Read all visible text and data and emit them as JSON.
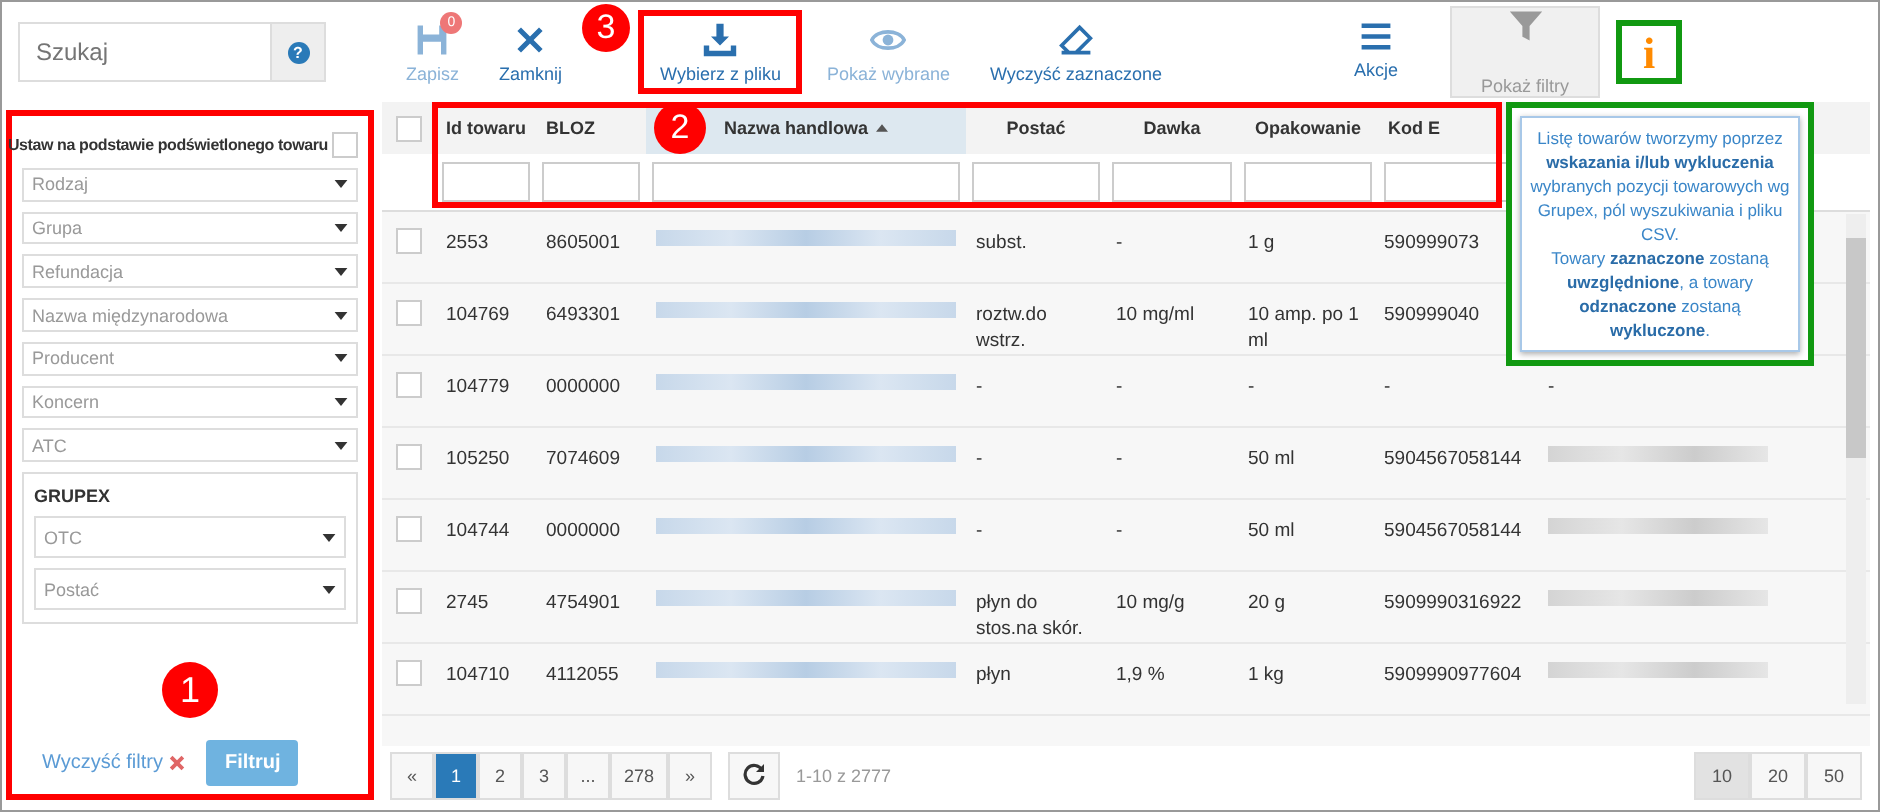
{
  "search": {
    "placeholder": "Szukaj",
    "help": "?"
  },
  "toolbar": [
    {
      "kind": "save",
      "label": "Zapisz",
      "disabled": true,
      "badge": "0"
    },
    {
      "kind": "close",
      "label": "Zamknij",
      "disabled": false
    },
    {
      "kind": "download",
      "label": "Wybierz z pliku",
      "disabled": false,
      "annotation": {
        "label": "3",
        "color": "#ff0000"
      }
    },
    {
      "kind": "eye",
      "label": "Pokaż wybrane",
      "disabled": true
    },
    {
      "kind": "eraser",
      "label": "Wyczyść zaznaczone",
      "disabled": false
    }
  ],
  "actions": {
    "label": "Akcje"
  },
  "show_filters": {
    "label": "Pokaż filtry",
    "selected": true
  },
  "info_button": {
    "label": "i",
    "annotation": {
      "color": "#119911"
    }
  },
  "tooltip": {
    "text": "Listę towarów tworzymy poprzez **wskazania i/lub wykluczenia** wybranych pozycji towarowych wg Grupex, pól wyszukiwania i pliku CSV.\nTowary **zaznaczone** zostaną **uwzględnione**, a towary **odznaczone** zostaną **wykluczone**.",
    "annotation": {
      "color": "#119911"
    }
  },
  "filters": {
    "annotation": {
      "label": "1",
      "color": "#ff0000"
    },
    "highlight_label": "Ustaw na podstawie podświetlonego towaru",
    "highlight_checked": false,
    "selects": [
      {
        "placeholder": "Rodzaj"
      },
      {
        "placeholder": "Grupa"
      },
      {
        "placeholder": "Refundacja"
      },
      {
        "placeholder": "Nazwa międzynarodowa"
      },
      {
        "placeholder": "Producent"
      },
      {
        "placeholder": "Koncern"
      },
      {
        "placeholder": "ATC"
      }
    ],
    "grupex": {
      "title": "GRUPEX",
      "selects": [
        {
          "placeholder": "OTC"
        },
        {
          "placeholder": "Postać"
        }
      ]
    },
    "clear": "Wyczyść filtry",
    "submit": "Filtruj"
  },
  "table": {
    "annotation": {
      "label": "2",
      "color": "#ff0000"
    },
    "select_all_checked": false,
    "columns": [
      {
        "label": "Id towaru",
        "sorted": false
      },
      {
        "label": "BLOZ",
        "sorted": false
      },
      {
        "label": "Nazwa handlowa",
        "sorted": true
      },
      {
        "label": "Postać",
        "sorted": false
      },
      {
        "label": "Dawka",
        "sorted": false
      },
      {
        "label": "Opakowanie",
        "sorted": false
      },
      {
        "label": "Kod E",
        "sorted": false
      }
    ],
    "rows": [
      {
        "checked": false,
        "id": "2553",
        "bloz": "8605001",
        "form": "subst.",
        "dose": "-",
        "pack": "1 g",
        "ean": "590999073"
      },
      {
        "checked": false,
        "id": "104769",
        "bloz": "6493301",
        "form": "roztw.do wstrz.",
        "dose": "10 mg/ml",
        "pack": "10 amp. po 1 ml",
        "ean": "590999040"
      },
      {
        "checked": false,
        "id": "104779",
        "bloz": "0000000",
        "form": "-",
        "dose": "-",
        "pack": "-",
        "ean": "-",
        "producer": "-",
        "producer_redacted": false
      },
      {
        "checked": false,
        "id": "105250",
        "bloz": "7074609",
        "form": "-",
        "dose": "-",
        "pack": "50 ml",
        "ean": "5904567058144",
        "producer": "",
        "producer_redacted": true
      },
      {
        "checked": false,
        "id": "104744",
        "bloz": "0000000",
        "form": "-",
        "dose": "-",
        "pack": "50 ml",
        "ean": "5904567058144",
        "producer": "",
        "producer_redacted": true
      },
      {
        "checked": false,
        "id": "2745",
        "bloz": "4754901",
        "form": "płyn do stos.na skór.",
        "dose": "10 mg/g",
        "pack": "20 g",
        "ean": "5909990316922",
        "producer": "",
        "producer_redacted": true
      },
      {
        "checked": false,
        "id": "104710",
        "bloz": "4112055",
        "form": "płyn",
        "dose": "1,9 %",
        "pack": "1 kg",
        "ean": "5909990977604",
        "producer": "",
        "producer_redacted": true
      }
    ]
  },
  "pagination": {
    "prev": "«",
    "next": "»",
    "pages": [
      {
        "label": "1",
        "selected": true
      },
      {
        "label": "2",
        "selected": false
      },
      {
        "label": "3",
        "selected": false
      },
      {
        "label": "...",
        "selected": false
      },
      {
        "label": "278",
        "selected": false
      }
    ],
    "summary": "1-10 z 2777",
    "sizes": [
      {
        "label": "10",
        "selected": true
      },
      {
        "label": "20",
        "selected": false
      },
      {
        "label": "50",
        "selected": false
      }
    ]
  }
}
